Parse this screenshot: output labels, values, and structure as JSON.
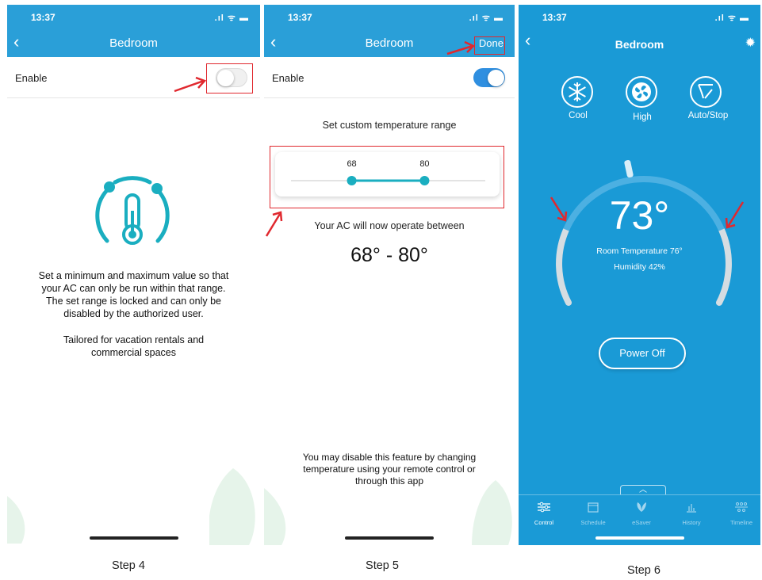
{
  "steps": [
    {
      "status_time": "13:37",
      "nav_title": "Bedroom",
      "enable_label": "Enable",
      "toggle_state": "off",
      "description": [
        "Set a minimum and maximum value so that",
        "your AC can only be run within that range.",
        "The set range is locked and can only be",
        "disabled by the authorized user."
      ],
      "tagline": [
        "Tailored for vacation rentals and",
        "commercial spaces"
      ],
      "step_label": "Step 4"
    },
    {
      "status_time": "13:37",
      "nav_title": "Bedroom",
      "done_label": "Done",
      "enable_label": "Enable",
      "toggle_state": "on",
      "range_title": "Set custom temperature range",
      "slider_min": 68,
      "slider_max": 80,
      "slider_min_label": "68",
      "slider_max_label": "80",
      "operate_text": "Your AC will now operate between",
      "range_display": "68° - 80°",
      "disable_note": [
        "You may disable this feature by changing",
        "temperature using your remote control or",
        "through this app"
      ],
      "step_label": "Step 5"
    },
    {
      "status_time": "13:37",
      "nav_title": "Bedroom",
      "modes": [
        {
          "label": "Cool",
          "icon": "snowflake-icon"
        },
        {
          "label": "High",
          "icon": "fan-icon"
        },
        {
          "label": "Auto/Stop",
          "icon": "swing-icon"
        }
      ],
      "set_temperature": "73°",
      "room_temperature": "Room Temperature 76°",
      "humidity": "Humidity 42%",
      "power_button": "Power Off",
      "tabs": [
        {
          "label": "Control",
          "icon": "sliders-icon",
          "active": true
        },
        {
          "label": "Schedule",
          "icon": "calendar-icon",
          "active": false
        },
        {
          "label": "eSaver",
          "icon": "leaf-icon",
          "active": false
        },
        {
          "label": "History",
          "icon": "bar-chart-icon",
          "active": false
        },
        {
          "label": "Timeline",
          "icon": "timeline-icon",
          "active": false
        }
      ],
      "step_label": "Step 6"
    }
  ],
  "colors": {
    "header_blue": "#2a9fd8",
    "app_blue": "#1a9ad6",
    "accent_teal": "#1aaec0",
    "highlight_red": "#e0282e",
    "toggle_on": "#2f8fe0"
  }
}
